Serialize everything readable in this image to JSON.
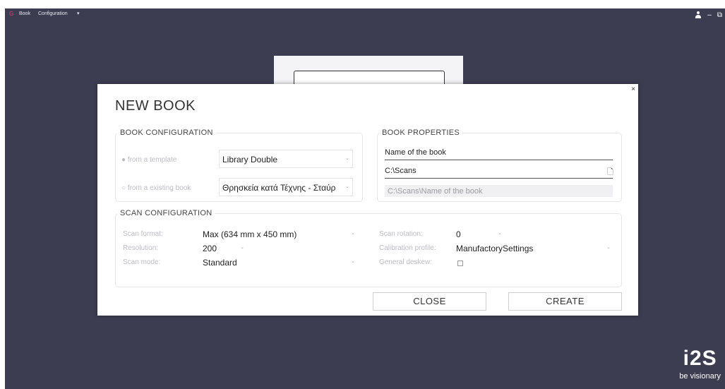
{
  "topbar": {
    "logo": "G",
    "menu_book": "Book",
    "menu_configuration": "Configuration",
    "chevron": "▾",
    "minimize": "–",
    "restore": "⧉"
  },
  "background_card": {
    "button_label": ""
  },
  "brand": {
    "logo": "i2S",
    "tagline": "be visionary"
  },
  "dialog": {
    "title": "NEW BOOK",
    "close_glyph": "×",
    "book_configuration": {
      "legend": "BOOK CONFIGURATION",
      "from_template_label": "from a template",
      "template_value": "Library Double",
      "from_existing_label": "from a existing book",
      "existing_value": "Θρησκεία κατά Τέχνης - Σταύρ"
    },
    "book_properties": {
      "legend": "BOOK PROPERTIES",
      "name_value": "Name of the book",
      "path_value": "C:\\Scans",
      "full_path_value": "C:\\Scans\\Name of the book"
    },
    "scan_configuration": {
      "legend": "SCAN CONFIGURATION",
      "scan_format_label": "Scan format:",
      "scan_format_value": "Max (634 mm x 450 mm)",
      "resolution_label": "Resolution:",
      "resolution_value": "200",
      "scan_mode_label": "Scan mode:",
      "scan_mode_value": "Standard",
      "scan_rotation_label": "Scan rotation:",
      "scan_rotation_value": "0",
      "calibration_label": "Calibration profile:",
      "calibration_value": "ManufactorySettings",
      "deskew_label": "General deskew:"
    },
    "buttons": {
      "close": "CLOSE",
      "create": "CREATE"
    }
  },
  "colors": {
    "app_bg": "#3d3d52",
    "dialog_bg": "#ffffff",
    "accent_logo": "#e04080"
  }
}
